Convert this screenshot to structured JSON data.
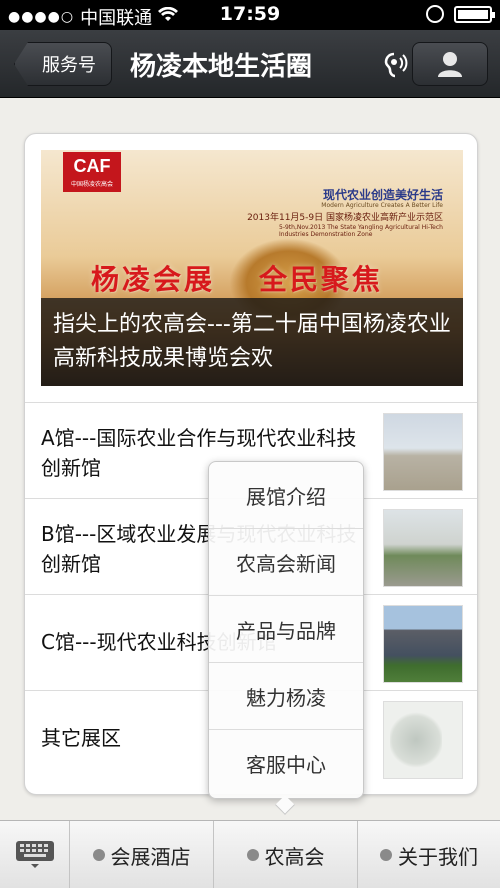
{
  "status_bar": {
    "carrier": "中国联通",
    "time": "17:59"
  },
  "nav": {
    "back_label": "服务号",
    "title": "杨凌本地生活圈"
  },
  "banner": {
    "logo_text": "CAF",
    "logo_sub": "中国杨凌农高会",
    "slogan": "现代农业创造美好生活",
    "slogan_en": "Modern Agriculture Creates A Better Life",
    "date_line": "2013年11月5-9日 国家杨凌农业高新产业示范区",
    "date_en": "5-9th,Nov.2013 The State Yangling Agricultural Hi-Tech Industries Demonstration Zone",
    "red_left": "杨凌会展",
    "red_right": "全民聚焦",
    "caption": "指尖上的农高会---第二十届中国杨凌农业高新科技成果博览会欢"
  },
  "list": [
    {
      "title": "A馆---国际农业合作与现代农业科技创新馆"
    },
    {
      "title": "B馆---区域农业发展与现代农业科技创新馆"
    },
    {
      "title": "C馆---现代农业科技创新馆"
    },
    {
      "title": "其它展区"
    }
  ],
  "popup_menu": [
    {
      "label": "展馆介绍"
    },
    {
      "label": "农高会新闻"
    },
    {
      "label": "产品与品牌"
    },
    {
      "label": "魅力杨凌"
    },
    {
      "label": "客服中心"
    }
  ],
  "tabbar": {
    "tabs": [
      {
        "label": "会展酒店"
      },
      {
        "label": "农高会"
      },
      {
        "label": "关于我们"
      }
    ]
  }
}
